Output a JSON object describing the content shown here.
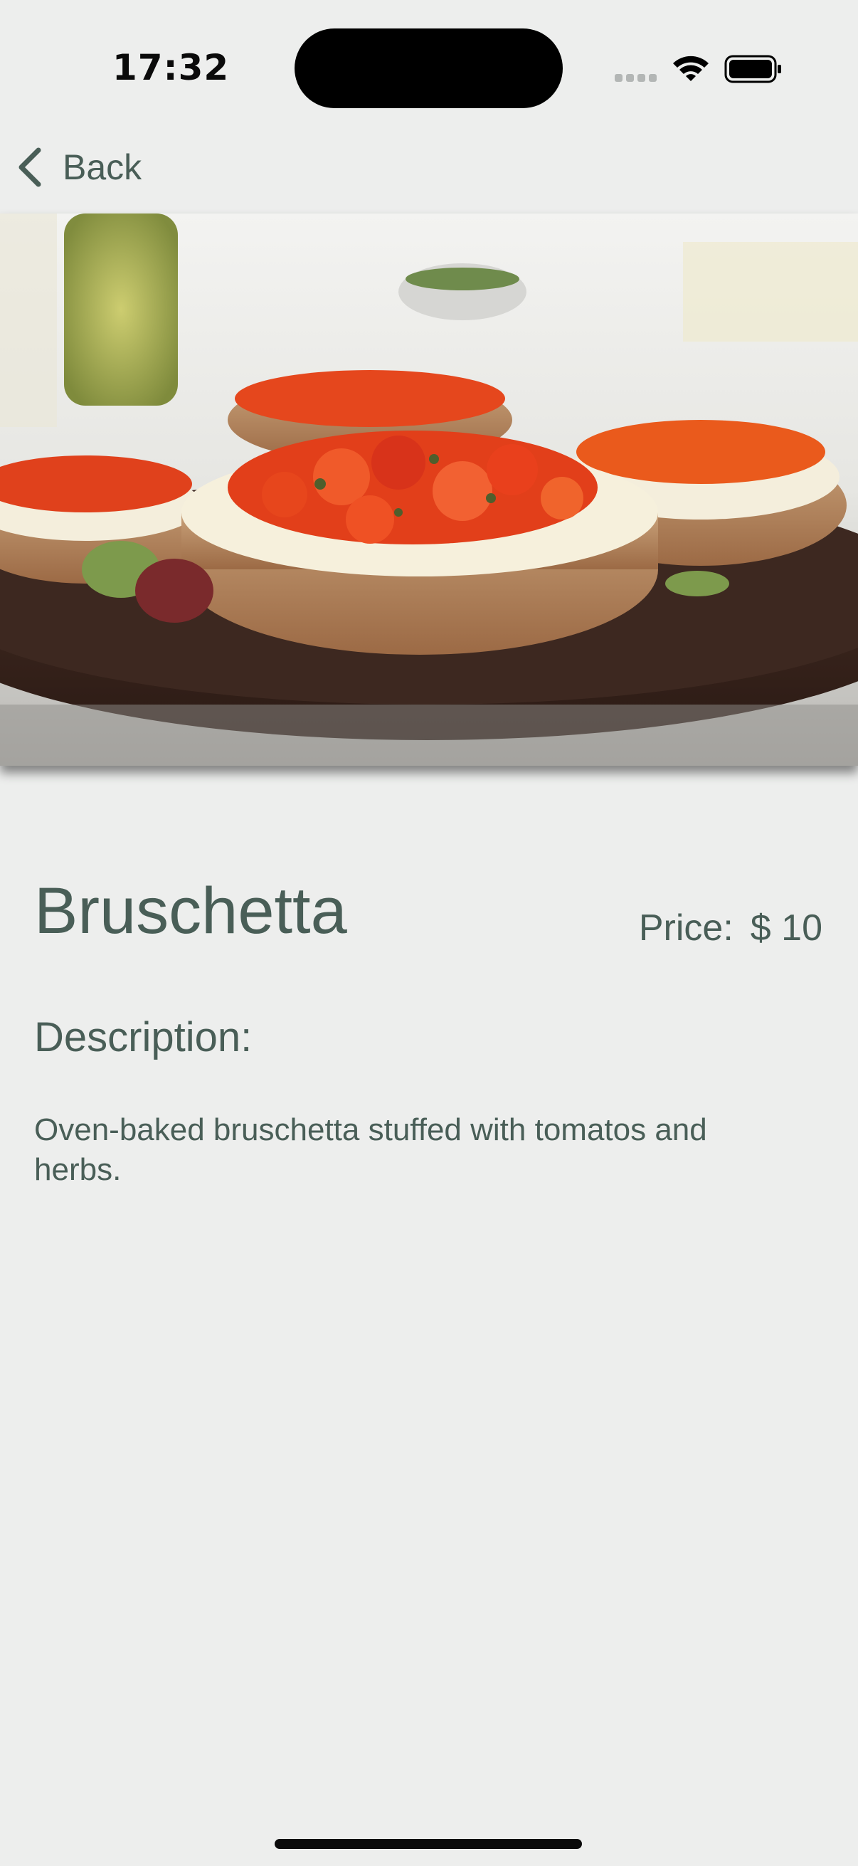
{
  "status_bar": {
    "time": "17:32",
    "icons": [
      "cellular-signal-icon",
      "wifi-icon",
      "battery-icon"
    ]
  },
  "nav": {
    "back_label": "Back",
    "back_icon": "chevron-left-icon"
  },
  "dish": {
    "image_description": "bruschetta-photo",
    "title": "Bruschetta",
    "price_label": "Price:",
    "price_value": "$ 10",
    "description_heading": "Description:",
    "description": "Oven-baked bruschetta stuffed with tomatos and herbs."
  },
  "colors": {
    "primary_text": "#495e57",
    "background": "#edeeed"
  }
}
